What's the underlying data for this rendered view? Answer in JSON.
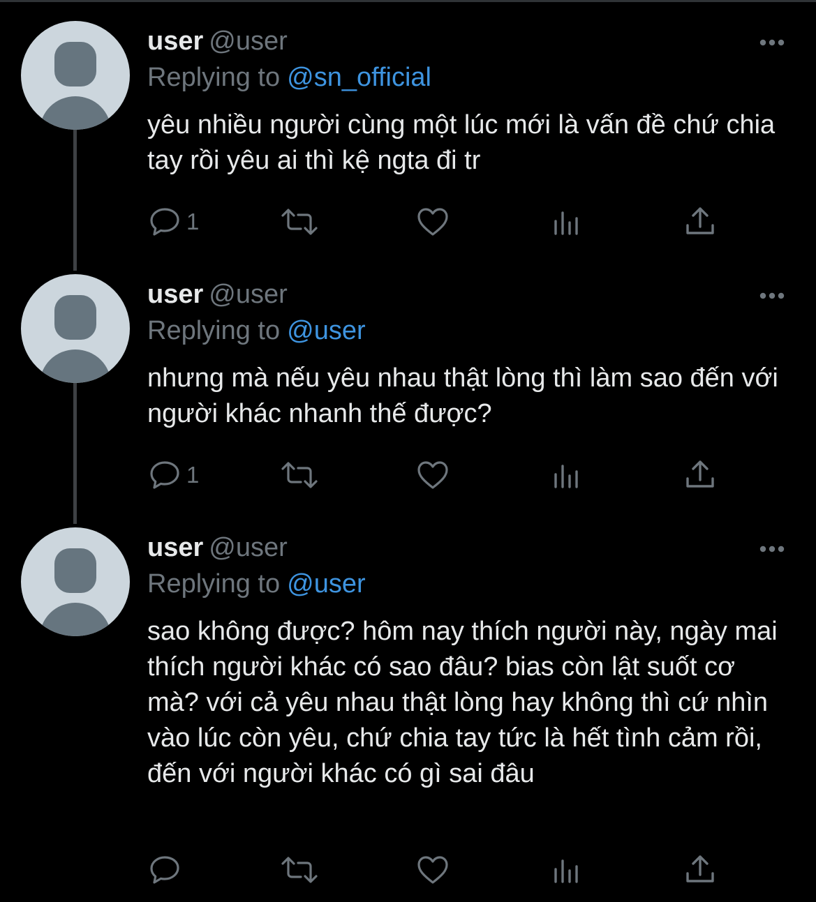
{
  "colors": {
    "background": "#000000",
    "text_primary": "#e7e9ea",
    "text_secondary": "#6e767d",
    "link": "#3e94e0",
    "thread_line": "#3e4144",
    "avatar_bg": "#ccd6dd",
    "avatar_fg": "#66757f"
  },
  "tweets": [
    {
      "display_name": "user",
      "handle": "@user",
      "replying_label": "Replying to",
      "replying_to": "@sn_official",
      "text": "yêu nhiều người cùng một lúc mới là vấn đề chứ chia tay rồi yêu ai thì kệ ngta đi tr",
      "reply_count": "1",
      "icons": [
        "avatar-placeholder",
        "more-icon",
        "reply-icon",
        "retweet-icon",
        "like-icon",
        "stats-icon",
        "share-icon"
      ]
    },
    {
      "display_name": "user",
      "handle": "@user",
      "replying_label": "Replying to",
      "replying_to": "@user",
      "text": "nhưng mà nếu yêu nhau thật lòng thì làm sao đến với người khác nhanh thế được?",
      "reply_count": "1",
      "icons": [
        "avatar-placeholder",
        "more-icon",
        "reply-icon",
        "retweet-icon",
        "like-icon",
        "stats-icon",
        "share-icon"
      ]
    },
    {
      "display_name": "user",
      "handle": "@user",
      "replying_label": "Replying to",
      "replying_to": "@user",
      "text": "sao không được? hôm nay thích người này, ngày mai thích người khác có sao đâu? bias còn lật suốt cơ mà? với cả yêu nhau thật lòng hay không thì cứ nhìn vào lúc còn yêu, chứ chia tay tức là hết tình cảm rồi, đến với người khác có gì sai đâu",
      "reply_count": "",
      "icons": [
        "avatar-placeholder",
        "more-icon",
        "reply-icon",
        "retweet-icon",
        "like-icon",
        "stats-icon",
        "share-icon"
      ]
    }
  ]
}
